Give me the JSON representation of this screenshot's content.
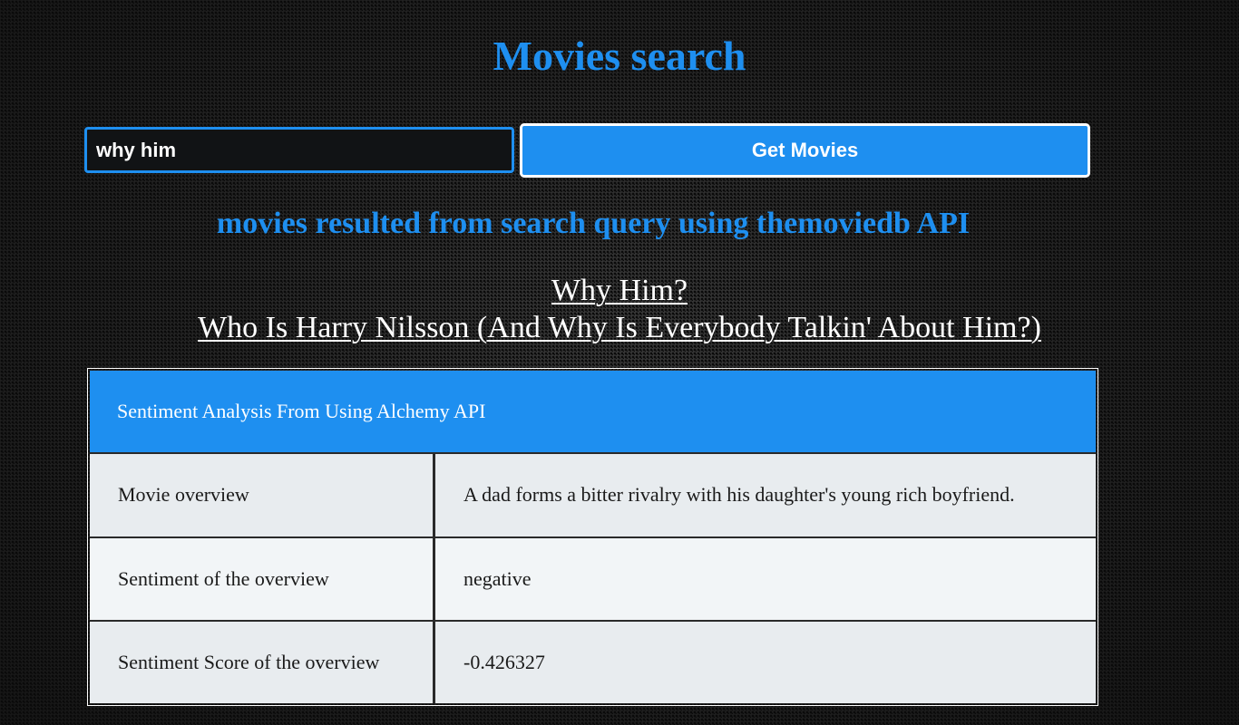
{
  "page": {
    "title": "Movies search",
    "subtitle": "movies resulted from search query using themoviedb API"
  },
  "search": {
    "value": "why him",
    "button_label": "Get Movies"
  },
  "results": [
    "Why Him?",
    "Who Is Harry Nilsson (And Why Is Everybody Talkin' About Him?)"
  ],
  "sentiment_table": {
    "header": "Sentiment Analysis From Using Alchemy API",
    "rows": [
      {
        "label": "Movie overview",
        "value": "A dad forms a bitter rivalry with his daughter's young rich boyfriend."
      },
      {
        "label": "Sentiment of the overview",
        "value": "negative"
      },
      {
        "label": "Sentiment Score of the overview",
        "value": "-0.426327"
      }
    ]
  },
  "colors": {
    "accent": "#1e8ff0",
    "background": "#1c1c1c",
    "link": "#ffffff"
  }
}
